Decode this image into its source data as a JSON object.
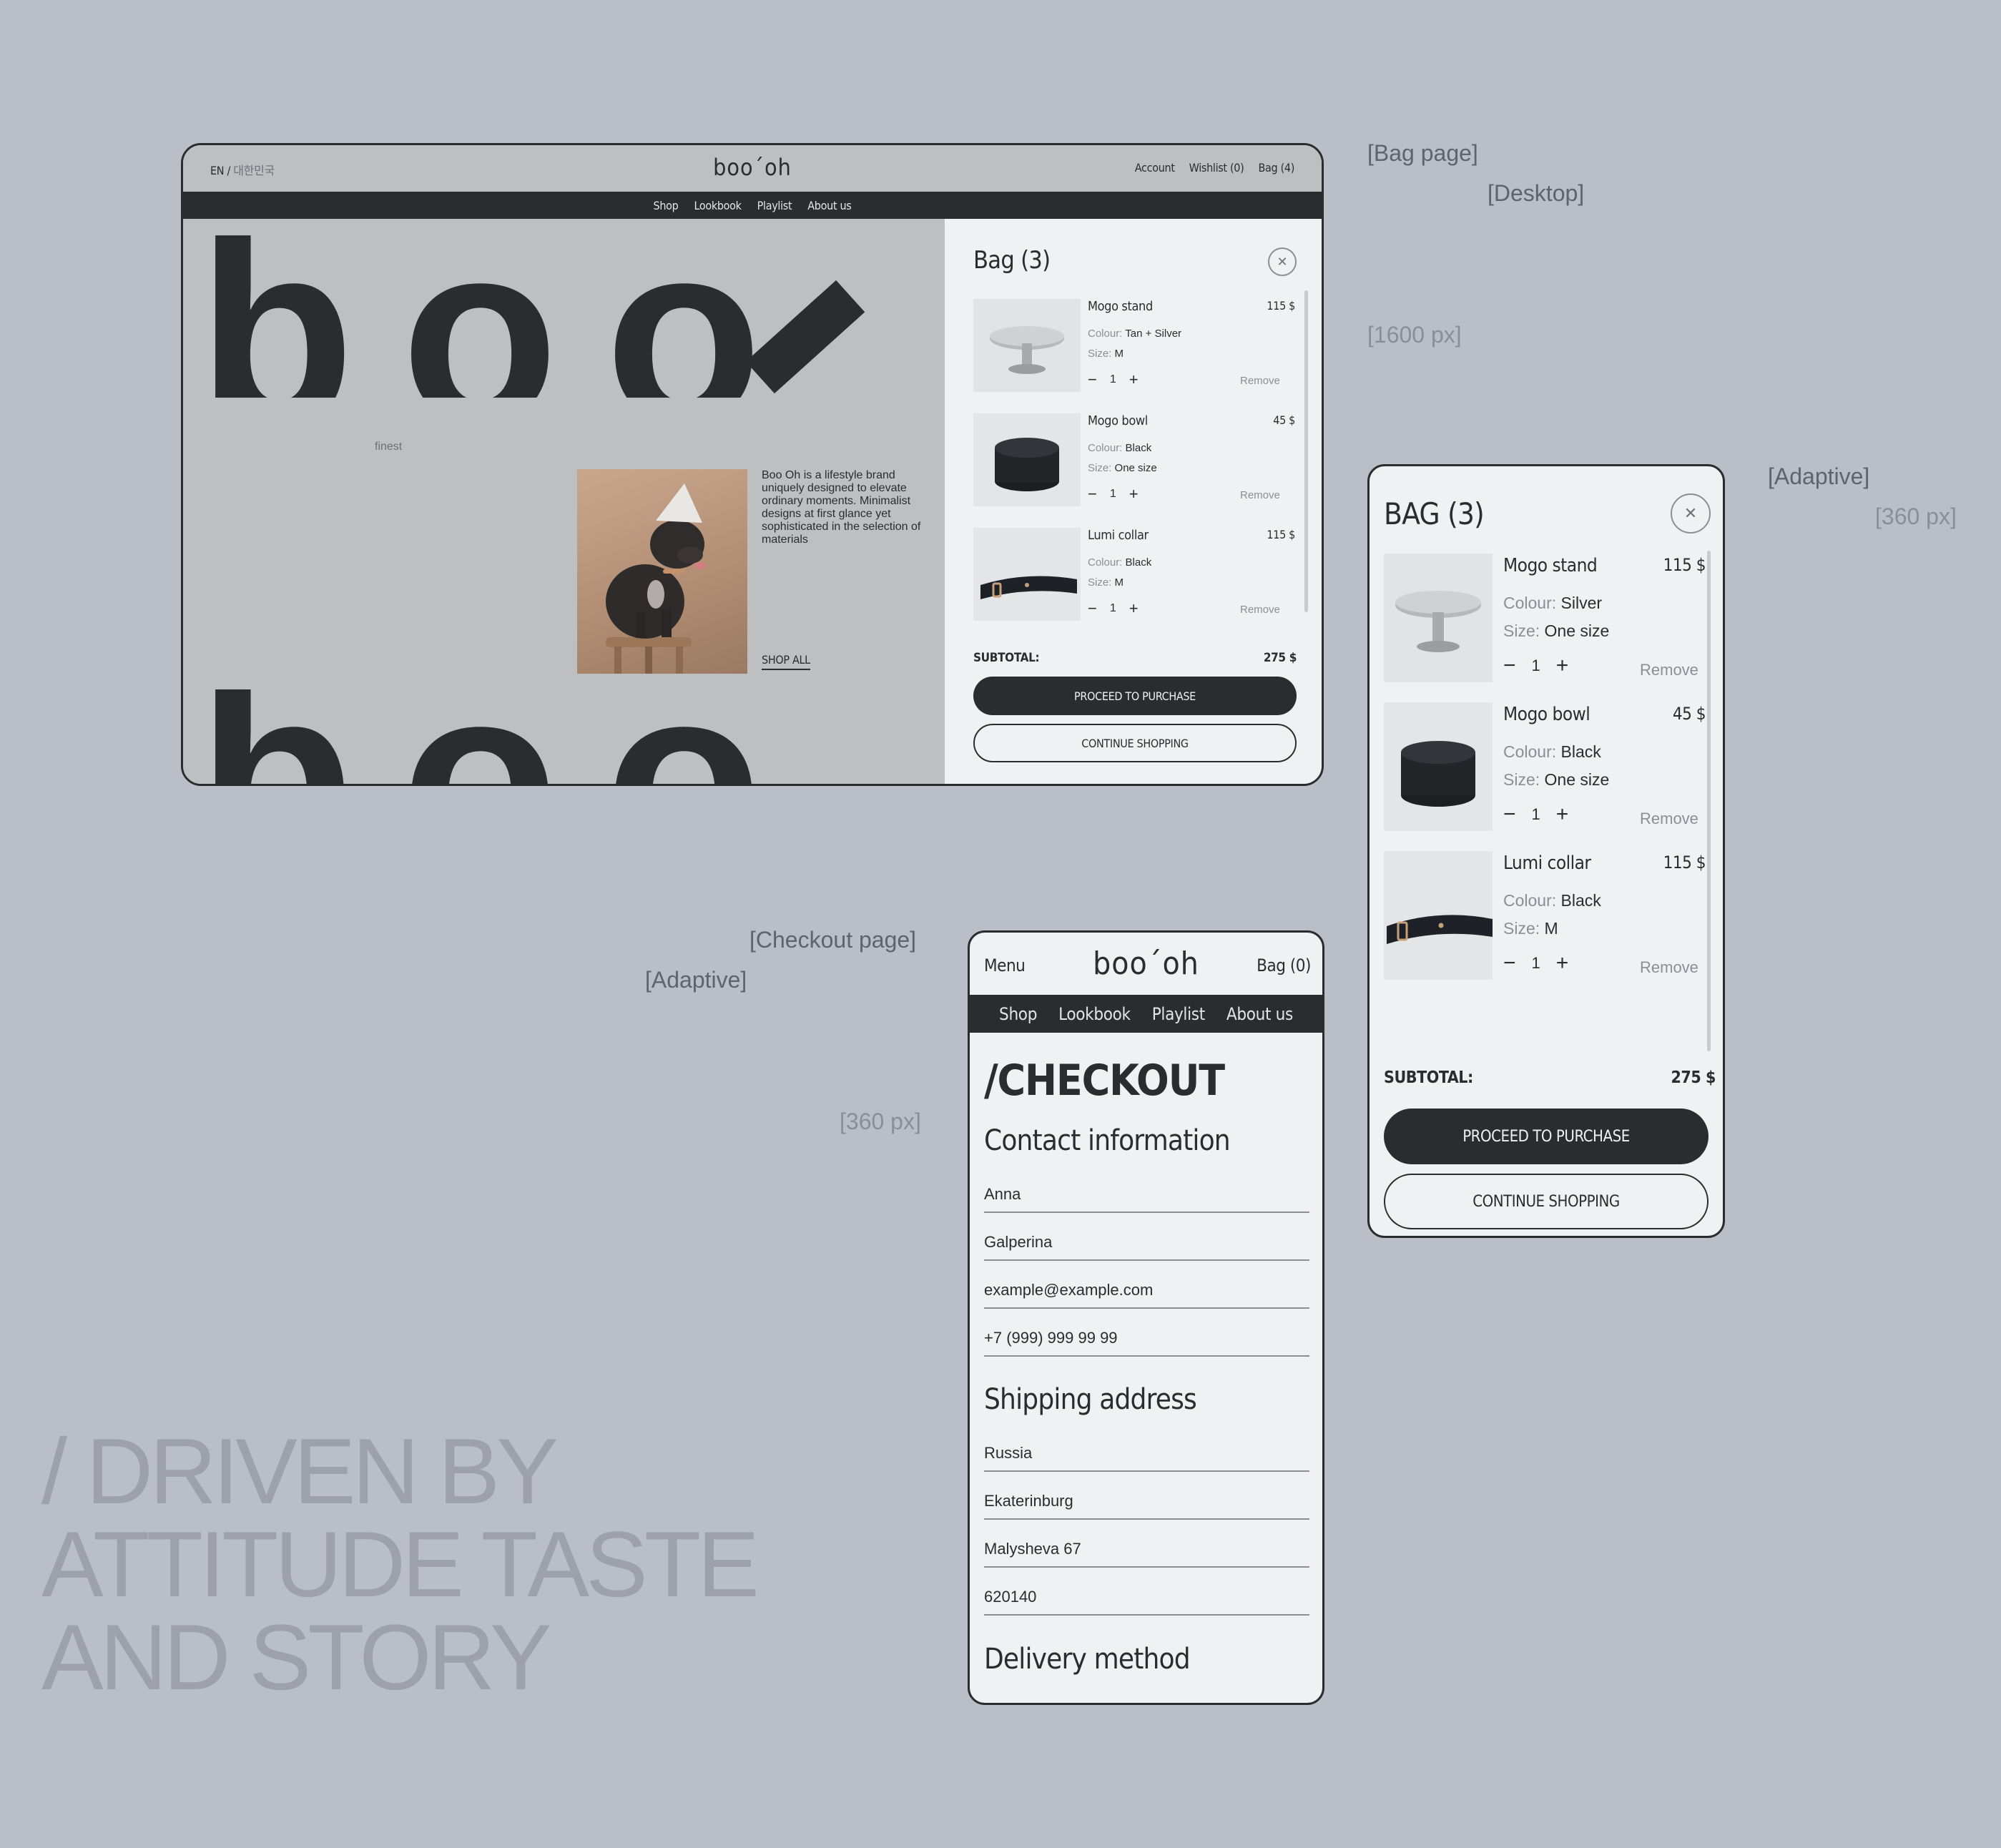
{
  "annotations": {
    "bag_page": "[Bag page]",
    "desktop": "[Desktop]",
    "desktop_width": "[1600 px]",
    "adaptive_bag": "[Adaptive]",
    "adaptive_bag_width": "[360 px]",
    "checkout_page": "[Checkout page]",
    "adaptive_checkout": "[Adaptive]",
    "adaptive_checkout_width": "[360 px]"
  },
  "headline": {
    "line1": "/ DRIVEN BY",
    "line2": "ATTITUDE TASTE",
    "line3": "AND STORY"
  },
  "desktop": {
    "lang_en": "EN /",
    "lang_ko": "대한민국",
    "logo": "boo´oh",
    "top_links": [
      "Account",
      "Wishlist (0)",
      "Bag (4)"
    ],
    "nav": [
      "Shop",
      "Lookbook",
      "Playlist",
      "About us"
    ],
    "hero": {
      "letters_top": [
        "b",
        "o",
        "o"
      ],
      "letters_bottom": [
        "b",
        "o",
        "o"
      ],
      "word_finest": "finest",
      "word_materials": "materials",
      "description": "Boo Oh is a lifestyle brand uniquely designed to elevate ordinary moments. Minimalist designs at first glance yet sophisticated in the selection of materials",
      "shop_all": "SHOP ALL"
    },
    "bag": {
      "title": "Bag (3)",
      "items": [
        {
          "name": "Mogo stand",
          "price": "115 $",
          "colour_label": "Colour:",
          "colour": "Tan + Silver",
          "size_label": "Size:",
          "size": "M",
          "qty": "1",
          "remove": "Remove"
        },
        {
          "name": "Mogo bowl",
          "price": "45 $",
          "colour_label": "Colour:",
          "colour": "Black",
          "size_label": "Size:",
          "size": "One size",
          "qty": "1",
          "remove": "Remove"
        },
        {
          "name": "Lumi collar",
          "price": "115 $",
          "colour_label": "Colour:",
          "colour": "Black",
          "size_label": "Size:",
          "size": "M",
          "qty": "1",
          "remove": "Remove"
        }
      ],
      "subtotal_label": "SUBTOTAL:",
      "subtotal": "275 $",
      "proceed": "PROCEED TO PURCHASE",
      "continue": "CONTINUE SHOPPING"
    }
  },
  "mobile_bag": {
    "title": "BAG (3)",
    "items": [
      {
        "name": "Mogo stand",
        "price": "115 $",
        "colour_label": "Colour:",
        "colour": "Silver",
        "size_label": "Size:",
        "size": "One size",
        "qty": "1",
        "remove": "Remove"
      },
      {
        "name": "Mogo bowl",
        "price": "45 $",
        "colour_label": "Colour:",
        "colour": "Black",
        "size_label": "Size:",
        "size": "One size",
        "qty": "1",
        "remove": "Remove"
      },
      {
        "name": "Lumi collar",
        "price": "115 $",
        "colour_label": "Colour:",
        "colour": "Black",
        "size_label": "Size:",
        "size": "M",
        "qty": "1",
        "remove": "Remove"
      }
    ],
    "subtotal_label": "SUBTOTAL:",
    "subtotal": "275 $",
    "proceed": "PROCEED TO PURCHASE",
    "continue": "CONTINUE SHOPPING"
  },
  "checkout": {
    "menu": "Menu",
    "logo": "boo´oh",
    "bag": "Bag (0)",
    "nav": [
      "Shop",
      "Lookbook",
      "Playlist",
      "About us"
    ],
    "title": "/CHECKOUT",
    "contact_heading": "Contact information",
    "contact_fields": [
      "Anna",
      "Galperina",
      "example@example.com",
      "+7 (999) 999 99 99"
    ],
    "shipping_heading": "Shipping address",
    "shipping_fields": [
      "Russia",
      "Ekaterinburg",
      "Malysheva 67",
      "620140"
    ],
    "delivery_heading": "Delivery method"
  },
  "colors": {
    "background": "#babec6",
    "dark": "#2b2c30",
    "panel": "#f0f1f2",
    "muted": "#8a8e96"
  }
}
